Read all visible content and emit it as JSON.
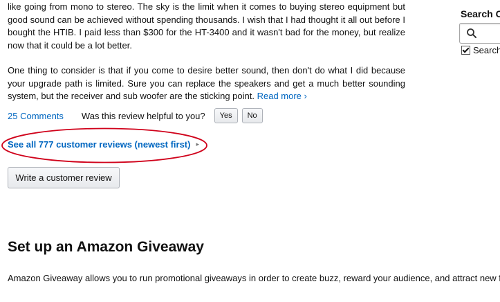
{
  "review": {
    "paragraph1": "like going from mono to stereo. The sky is the limit when it comes to buying stereo equipment but good sound can be achieved without spending thousands. I wish that I had thought it all out before I bought the HTIB. I paid less than $300 for the HT-3400 and it wasn't bad for the money, but realize now that it could be a lot better.",
    "paragraph2": "One thing to consider is that if you come to desire better sound, then don't do what I did because your upgrade path is limited. Sure you can replace the speakers and get a much better sounding system, but the receiver and sub woofer are the sticking point.",
    "read_more": "Read more ›"
  },
  "feedback": {
    "comments": "25 Comments",
    "question": "Was this review helpful to you?",
    "yes": "Yes",
    "no": "No"
  },
  "see_all_reviews": "See all 777 customer reviews (newest first)",
  "write_review": "Write a customer review",
  "giveaway": {
    "title": "Set up an Amazon Giveaway",
    "description": "Amazon Giveaway allows you to run promotional giveaways in order to create buzz, reward your audience, and attract new f"
  },
  "sidebar_search": {
    "heading": "Search C",
    "checkbox_label": "Search"
  },
  "colors": {
    "link": "#0066c0",
    "annotation": "#d0021b"
  }
}
